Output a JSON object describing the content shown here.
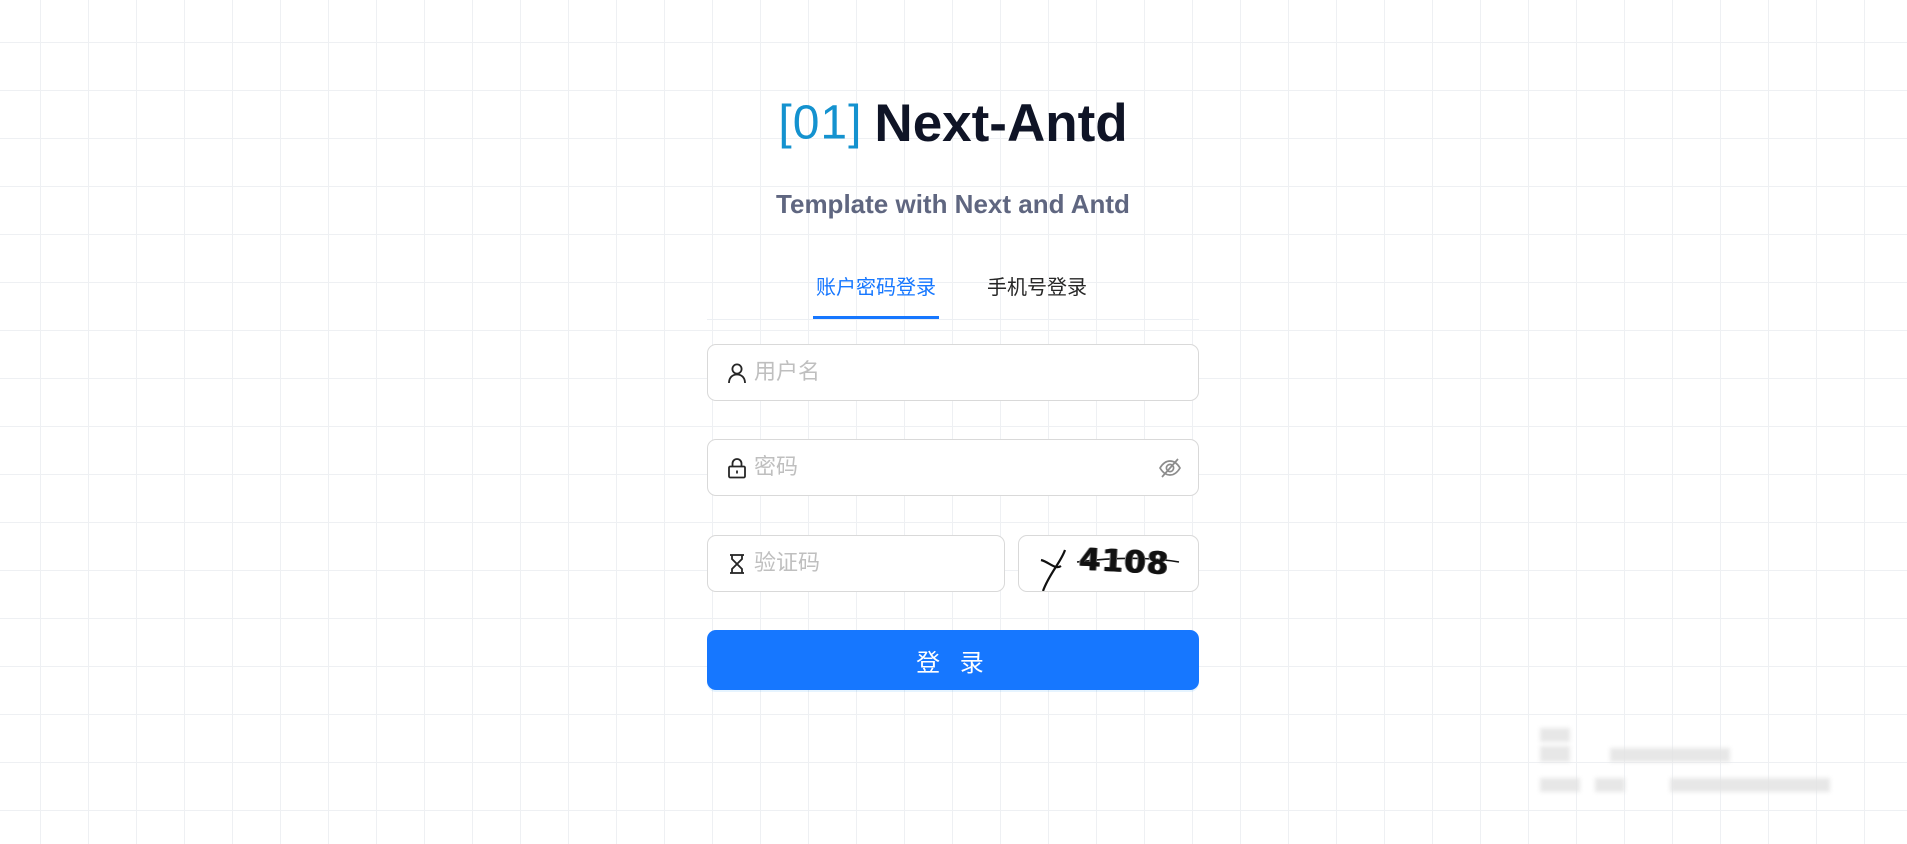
{
  "brand": {
    "mark": "[01]",
    "name": "Next-Antd",
    "subtitle": "Template with Next and Antd"
  },
  "tabs": [
    {
      "label": "账户密码登录",
      "active": true
    },
    {
      "label": "手机号登录",
      "active": false
    }
  ],
  "form": {
    "username": {
      "placeholder": "用户名",
      "value": "",
      "icon": "user-icon"
    },
    "password": {
      "placeholder": "密码",
      "value": "",
      "icon": "lock-icon",
      "toggle_icon": "eye-invisible-icon"
    },
    "captcha": {
      "placeholder": "验证码",
      "value": "",
      "icon": "hourglass-icon",
      "image_text": "4108"
    },
    "submit_label": "登 录"
  },
  "colors": {
    "primary": "#1677ff",
    "brand_mark": "#1492cf",
    "brand_name": "#0f1426",
    "subtitle": "#5f6680",
    "border": "#d9d9d9",
    "placeholder": "#bfbfbf"
  }
}
